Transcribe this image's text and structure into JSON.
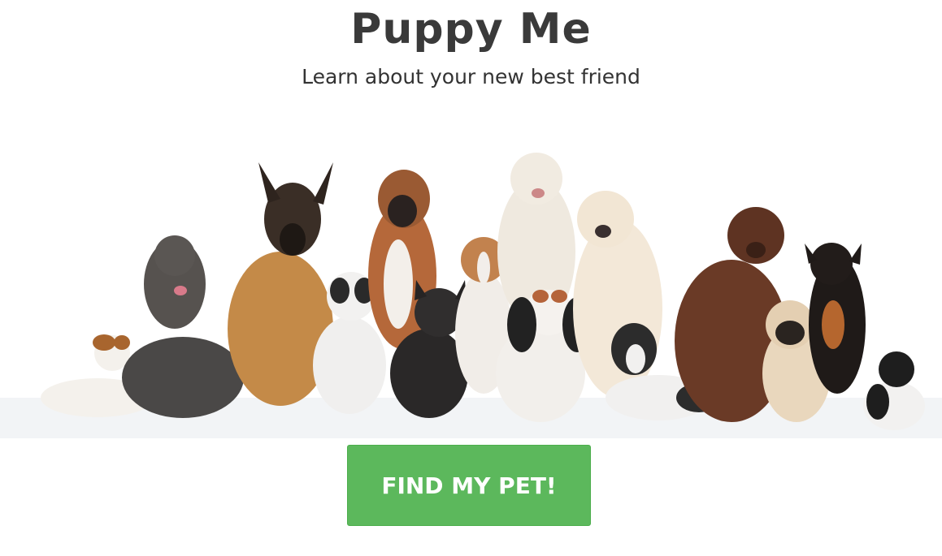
{
  "header": {
    "title": "Puppy Me",
    "subtitle": "Learn about your new best friend"
  },
  "hero": {
    "image": "group-of-dogs-photo",
    "dogs": [
      "jack-russell-terrier",
      "poodle",
      "german-shepherd",
      "french-bulldog-white",
      "boxer",
      "french-bulldog-black",
      "beagle",
      "akita",
      "cavalier-king-charles",
      "labrador",
      "boston-terrier",
      "chocolate-labrador",
      "pug",
      "miniature-pinscher",
      "toy-poodle"
    ]
  },
  "cta": {
    "label": "FIND MY PET!",
    "color": "#5cb85c"
  }
}
